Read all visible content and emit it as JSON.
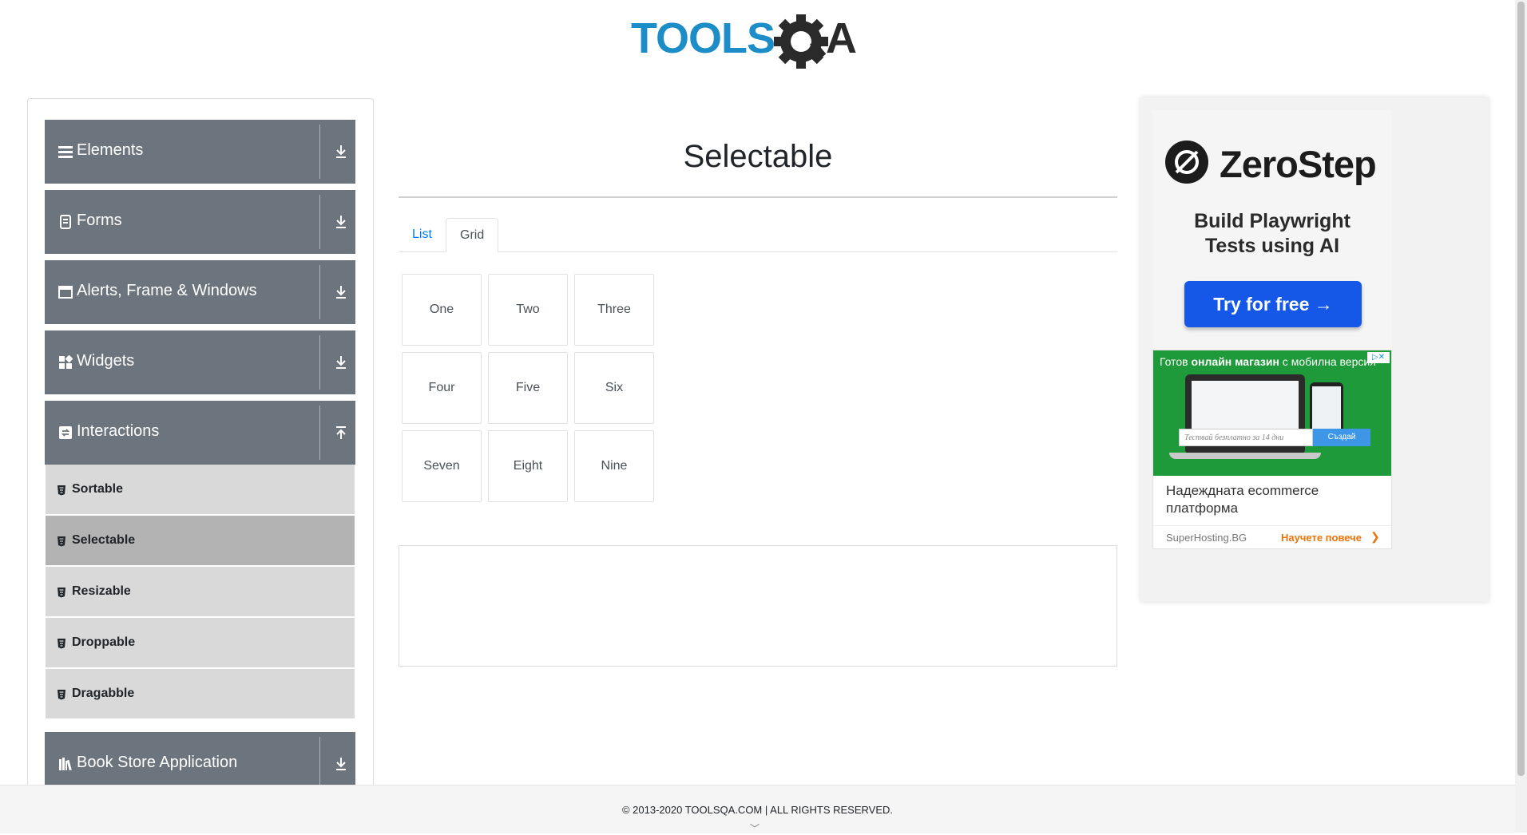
{
  "header": {
    "logo_part1": "TOOLS",
    "logo_part2": "QA"
  },
  "sidebar": {
    "groups": [
      {
        "label": "Elements",
        "icon": "menu-icon"
      },
      {
        "label": "Forms",
        "icon": "document-icon"
      },
      {
        "label": "Alerts, Frame & Windows",
        "icon": "window-icon"
      },
      {
        "label": "Widgets",
        "icon": "widgets-icon"
      },
      {
        "label": "Interactions",
        "icon": "interactions-icon"
      },
      {
        "label": "Book Store Application",
        "icon": "books-icon"
      }
    ],
    "interaction_items": [
      {
        "label": "Sortable",
        "active": false
      },
      {
        "label": "Selectable",
        "active": true
      },
      {
        "label": "Resizable",
        "active": false
      },
      {
        "label": "Droppable",
        "active": false
      },
      {
        "label": "Dragabble",
        "active": false
      }
    ]
  },
  "main": {
    "title": "Selectable",
    "tabs": [
      {
        "label": "List",
        "active": false
      },
      {
        "label": "Grid",
        "active": true
      }
    ],
    "grid_items": [
      "One",
      "Two",
      "Three",
      "Four",
      "Five",
      "Six",
      "Seven",
      "Eight",
      "Nine"
    ]
  },
  "ad": {
    "brand": "ZeroStep",
    "tagline_line1": "Build Playwright",
    "tagline_line2": "Tests using AI",
    "cta": "Try for free →",
    "banner_headline_pre": "Готов ",
    "banner_headline_bold": "онлайн магазин",
    "banner_headline_post": " с мобилна версия",
    "banner_search_placeholder": "Тествай безплатно за 14 дни",
    "banner_search_button": "Създай",
    "banner_text": "Надеждната ecommerce платформа",
    "banner_source": "SuperHosting.BG",
    "banner_cta": "Научете повече"
  },
  "footer": {
    "text": "© 2013-2020 TOOLSQA.COM | ALL RIGHTS RESERVED."
  },
  "colors": {
    "sidebar_group_bg": "#6c757d",
    "sidebar_item_bg": "#d9d9d9",
    "sidebar_item_active_bg": "#b3b3b3",
    "link_blue": "#007bff",
    "logo_blue": "#1d8dc7",
    "logo_dark": "#2a2a2a",
    "ad_button_blue": "#1558e8"
  }
}
